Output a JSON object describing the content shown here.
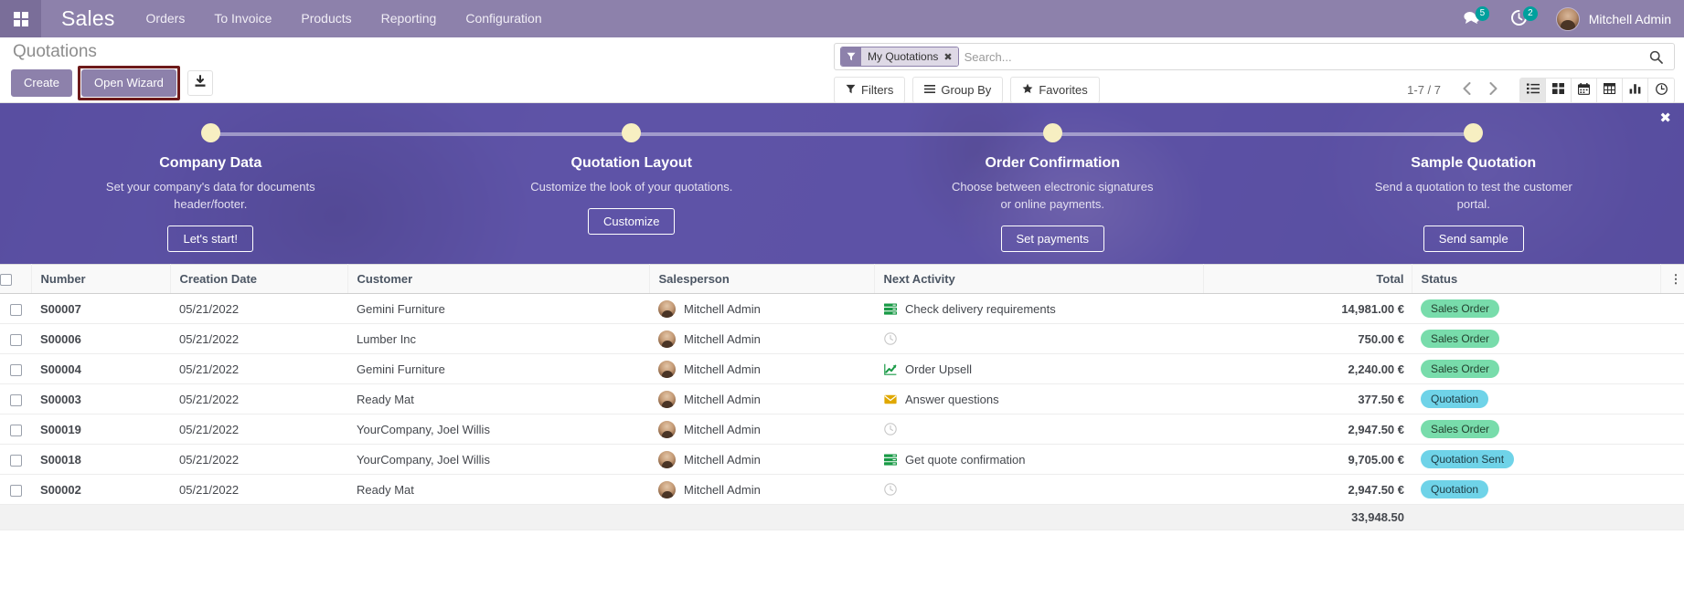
{
  "navbar": {
    "apps_icon": "grid-apps-icon",
    "brand": "Sales",
    "menu": [
      "Orders",
      "To Invoice",
      "Products",
      "Reporting",
      "Configuration"
    ],
    "messages_icon": "messages-icon",
    "messages_count": "5",
    "activities_icon": "activity-clock-icon",
    "activities_count": "2",
    "user_name": "Mitchell Admin"
  },
  "control_panel": {
    "breadcrumb": "Quotations",
    "create_label": "Create",
    "wizard_label": "Open Wizard",
    "export_icon": "download-export-icon",
    "search": {
      "facet_icon": "filter-funnel-icon",
      "facet_label": "My Quotations",
      "facet_close_icon": "close-x-icon",
      "placeholder": "Search...",
      "value": "",
      "search_icon": "search-icon"
    },
    "filters_label": "Filters",
    "groupby_label": "Group By",
    "favorites_label": "Favorites",
    "pager": "1-7 / 7",
    "prev_icon": "chevron-left-icon",
    "next_icon": "chevron-right-icon",
    "views": [
      {
        "name": "list-view",
        "icon": "list-icon",
        "active": true
      },
      {
        "name": "kanban-view",
        "icon": "kanban-icon",
        "active": false
      },
      {
        "name": "calendar-view",
        "icon": "calendar-icon",
        "active": false
      },
      {
        "name": "pivot-view",
        "icon": "pivot-table-icon",
        "active": false
      },
      {
        "name": "graph-view",
        "icon": "bar-chart-icon",
        "active": false
      },
      {
        "name": "activity-view",
        "icon": "clock-icon",
        "active": false
      }
    ]
  },
  "banner": {
    "close_icon": "close-x-icon",
    "steps": [
      {
        "title": "Company Data",
        "desc": "Set your company's data for documents header/footer.",
        "button": "Let's start!"
      },
      {
        "title": "Quotation Layout",
        "desc": "Customize the look of your quotations.",
        "button": "Customize"
      },
      {
        "title": "Order Confirmation",
        "desc": "Choose between electronic signatures or online payments.",
        "button": "Set payments"
      },
      {
        "title": "Sample Quotation",
        "desc": "Send a quotation to test the customer portal.",
        "button": "Send sample"
      }
    ]
  },
  "list": {
    "columns": [
      "Number",
      "Creation Date",
      "Customer",
      "Salesperson",
      "Next Activity",
      "Total",
      "Status"
    ],
    "rows": [
      {
        "number": "S00007",
        "date": "05/21/2022",
        "customer": "Gemini Furniture",
        "salesperson": "Mitchell Admin",
        "activity": "Check delivery requirements",
        "activity_icon": "server-list-icon",
        "total": "14,981.00 €",
        "status": "Sales Order",
        "status_type": "sales"
      },
      {
        "number": "S00006",
        "date": "05/21/2022",
        "customer": "Lumber Inc",
        "salesperson": "Mitchell Admin",
        "activity": "",
        "activity_icon": "clock-icon",
        "total": "750.00 €",
        "status": "Sales Order",
        "status_type": "sales"
      },
      {
        "number": "S00004",
        "date": "05/21/2022",
        "customer": "Gemini Furniture",
        "salesperson": "Mitchell Admin",
        "activity": "Order Upsell",
        "activity_icon": "chart-line-icon",
        "total": "2,240.00 €",
        "status": "Sales Order",
        "status_type": "sales"
      },
      {
        "number": "S00003",
        "date": "05/21/2022",
        "customer": "Ready Mat",
        "salesperson": "Mitchell Admin",
        "activity": "Answer questions",
        "activity_icon": "envelope-icon",
        "total": "377.50 €",
        "status": "Quotation",
        "status_type": "quote"
      },
      {
        "number": "S00019",
        "date": "05/21/2022",
        "customer": "YourCompany, Joel Willis",
        "salesperson": "Mitchell Admin",
        "activity": "",
        "activity_icon": "clock-icon",
        "total": "2,947.50 €",
        "status": "Sales Order",
        "status_type": "sales"
      },
      {
        "number": "S00018",
        "date": "05/21/2022",
        "customer": "YourCompany, Joel Willis",
        "salesperson": "Mitchell Admin",
        "activity": "Get quote confirmation",
        "activity_icon": "server-list-icon",
        "total": "9,705.00 €",
        "status": "Quotation Sent",
        "status_type": "sent"
      },
      {
        "number": "S00002",
        "date": "05/21/2022",
        "customer": "Ready Mat",
        "salesperson": "Mitchell Admin",
        "activity": "",
        "activity_icon": "clock-icon",
        "total": "2,947.50 €",
        "status": "Quotation",
        "status_type": "quote"
      }
    ],
    "footer_total": "33,948.50",
    "options_icon": "column-options-icon"
  }
}
